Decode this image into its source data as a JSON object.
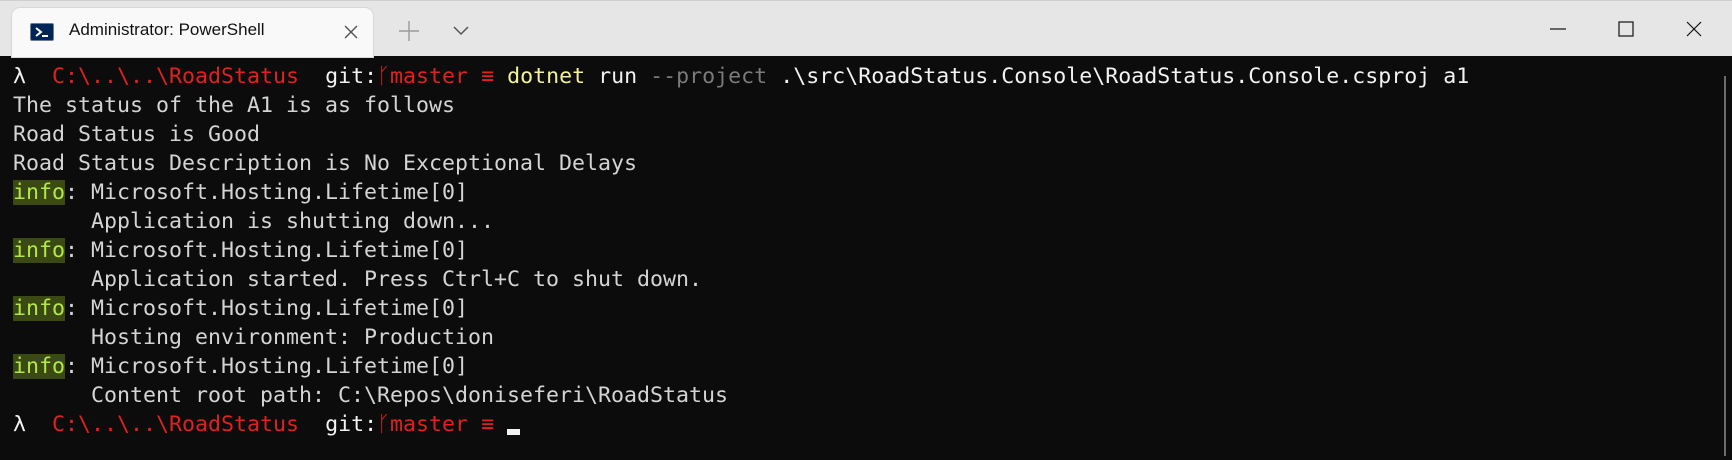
{
  "window": {
    "tab_title": "Administrator: PowerShell",
    "tab_icon": "powershell-icon",
    "new_tab_icon": "plus-icon",
    "dropdown_icon": "chevron-down-icon",
    "minimize_icon": "minimize-icon",
    "maximize_icon": "maximize-icon",
    "close_icon": "close-icon"
  },
  "prompt": {
    "lambda": "λ",
    "path": "C:\\..\\..\\RoadStatus",
    "git_label": "git:",
    "branch_glyph": "ᚴ",
    "branch": "master",
    "status_glyph": "≡"
  },
  "command": {
    "name": "dotnet",
    "verb": "run",
    "flag": "--project",
    "args": ".\\src\\RoadStatus.Console\\RoadStatus.Console.csproj a1"
  },
  "output": {
    "line1": "The status of the A1 is as follows",
    "line2": "Road Status is Good",
    "line3": "Road Status Description is No Exceptional Delays",
    "info_label": "info",
    "logger": ": Microsoft.Hosting.Lifetime[0]",
    "msg1": "      Application is shutting down...",
    "msg2": "      Application started. Press Ctrl+C to shut down.",
    "msg3": "      Hosting environment: Production",
    "msg4": "      Content root path: C:\\Repos\\doniseferi\\RoadStatus"
  },
  "colors": {
    "background": "#0c0c0c",
    "path": "#e0211f",
    "command": "#f2f29b",
    "info_fg": "#b3e84a",
    "info_bg": "#3a4a12"
  }
}
